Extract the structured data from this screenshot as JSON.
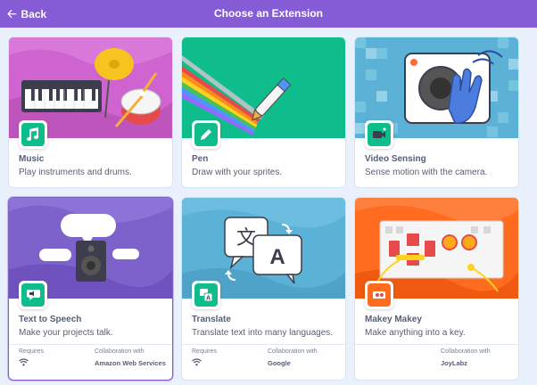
{
  "header": {
    "back_label": "Back",
    "back_icon": "left-arrow-icon",
    "title": "Choose an Extension"
  },
  "colors": {
    "header": "#855cd6",
    "background": "#e9f1fc",
    "text": "#575e75"
  },
  "extensions": [
    {
      "name": "Music",
      "description": "Play instruments and drums.",
      "icon": "music-notes-icon",
      "art": "keyboard-and-drums-illustration"
    },
    {
      "name": "Pen",
      "description": "Draw with your sprites.",
      "icon": "pen-icon",
      "art": "pen-drawing-rainbow-illustration"
    },
    {
      "name": "Video Sensing",
      "description": "Sense motion with the camera.",
      "icon": "video-camera-icon",
      "art": "camera-and-hand-illustration"
    },
    {
      "name": "Text to Speech",
      "description": "Make your projects talk.",
      "icon": "speaker-speech-icon",
      "art": "speaker-with-speech-bubbles-illustration",
      "requires_label": "Requires",
      "requires_icon": "wifi-icon",
      "collab_label": "Collaboration with",
      "collab_value": "Amazon Web Services"
    },
    {
      "name": "Translate",
      "description": "Translate text into many languages.",
      "icon": "translate-icon",
      "art": "translate-bubbles-illustration",
      "requires_label": "Requires",
      "requires_icon": "wifi-icon",
      "collab_label": "Collaboration with",
      "collab_value": "Google"
    },
    {
      "name": "Makey Makey",
      "description": "Make anything into a key.",
      "icon": "makey-makey-icon",
      "art": "makey-makey-board-illustration",
      "collab_label": "Collaboration with",
      "collab_value": "JoyLabz"
    }
  ]
}
